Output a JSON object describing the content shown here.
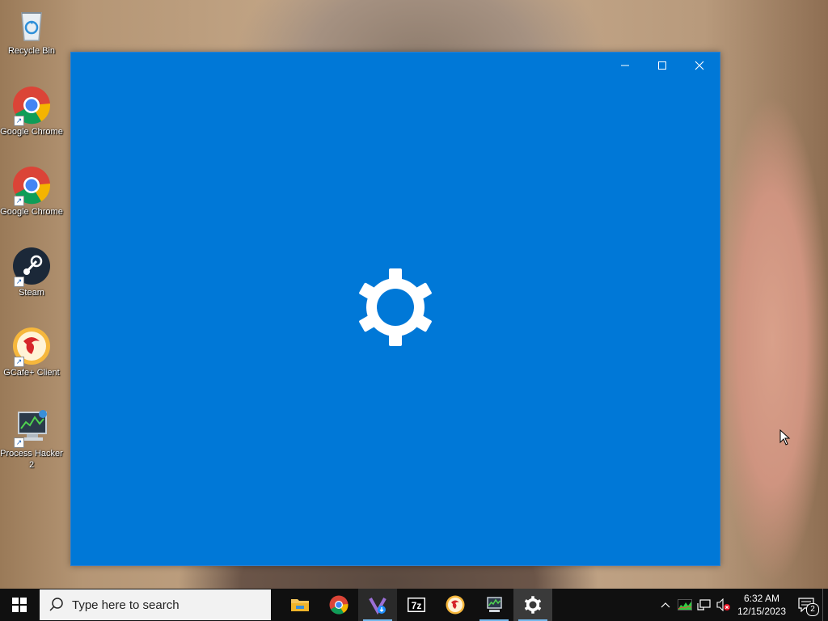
{
  "desktop": {
    "icons": [
      {
        "label": "Recycle Bin"
      },
      {
        "label": "Google Chrome"
      },
      {
        "label": "Google Chrome"
      },
      {
        "label": "Steam"
      },
      {
        "label": "GCafe+ Client"
      },
      {
        "label": "Process Hacker 2"
      }
    ]
  },
  "window": {
    "app": "Settings",
    "icon": "gear-icon",
    "background_color": "#0078d7",
    "controls": [
      "minimize",
      "maximize",
      "close"
    ]
  },
  "taskbar": {
    "search_placeholder": "Type here to search",
    "apps": [
      {
        "icon": "file-explorer-icon"
      },
      {
        "icon": "chrome-icon"
      },
      {
        "icon": "visual-studio-installer-icon"
      },
      {
        "icon": "7zip-icon"
      },
      {
        "icon": "gcafe-icon"
      },
      {
        "icon": "process-hacker-icon"
      },
      {
        "icon": "settings-gear-icon"
      }
    ],
    "clock": {
      "time": "6:32 AM",
      "date": "12/15/2023"
    },
    "notification_count": "2"
  }
}
